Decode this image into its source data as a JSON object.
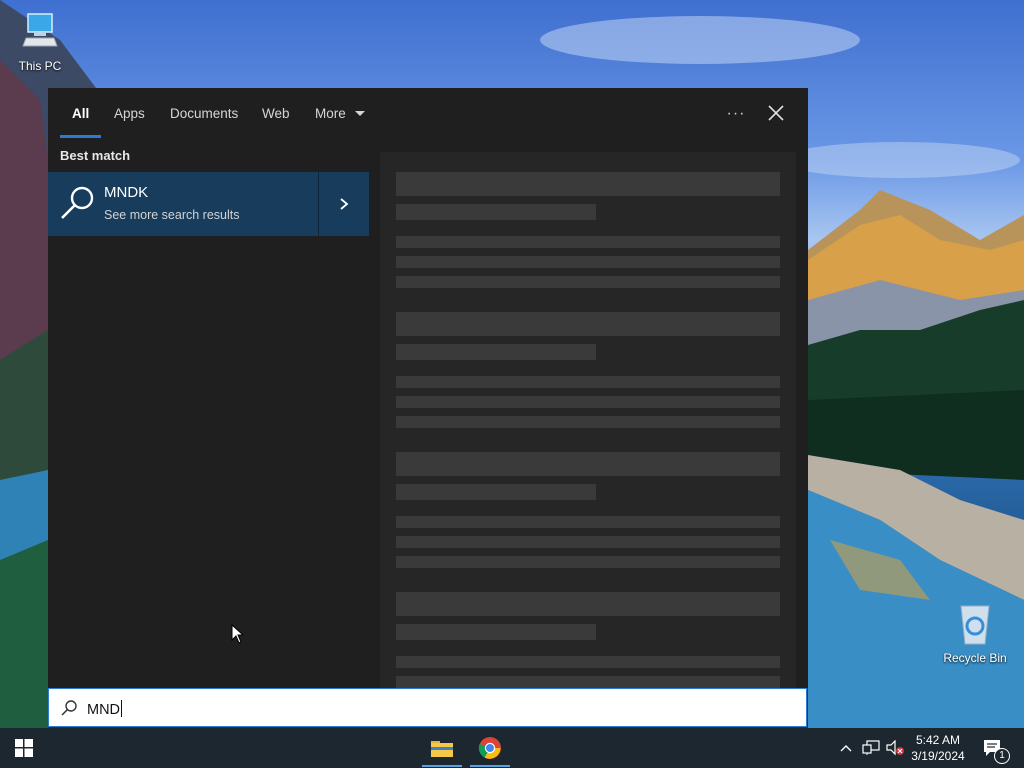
{
  "desktop": {
    "icons": [
      {
        "label": "This PC"
      },
      {
        "label": "Recycle Bin"
      }
    ]
  },
  "search_panel": {
    "tabs": [
      {
        "label": "All",
        "active": true
      },
      {
        "label": "Apps"
      },
      {
        "label": "Documents"
      },
      {
        "label": "Web"
      },
      {
        "label": "More"
      }
    ],
    "more_options_label": "···",
    "best_match_title": "Best match",
    "best_match": {
      "title": "MNDK",
      "subtitle": "See more search results"
    },
    "search_box": {
      "value": "MND"
    }
  },
  "taskbar": {
    "clock_time": "5:42 AM",
    "clock_date": "3/19/2024",
    "notification_count": "1"
  },
  "colors": {
    "accent": "#2a7bd1",
    "panel_bg": "#1f1f1f",
    "best_match_bg": "#173c5c"
  }
}
